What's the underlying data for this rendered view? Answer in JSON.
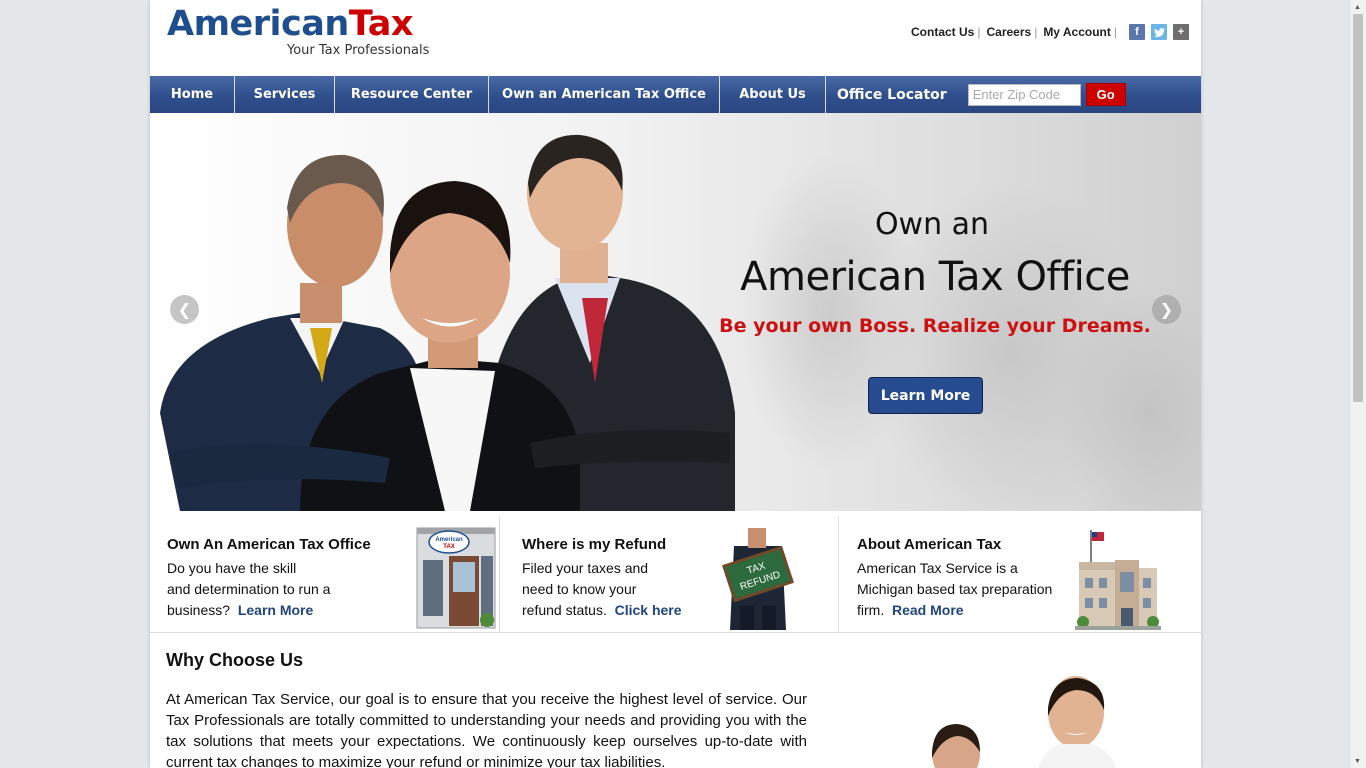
{
  "header": {
    "logo_part1": "American",
    "logo_part2": "Tax",
    "tagline": "Your Tax Professionals",
    "links": [
      "Contact Us",
      "Careers",
      "My Account"
    ],
    "social_icons": [
      "facebook-icon",
      "twitter-icon",
      "google-plus-icon"
    ]
  },
  "nav": {
    "items": [
      "Home",
      "Services",
      "Resource Center",
      "Own an American Tax Office",
      "About Us"
    ],
    "office_locator_label": "Office Locator",
    "zip_placeholder": "Enter Zip Code",
    "go_label": "Go"
  },
  "hero": {
    "line1": "Own an",
    "line2": "American Tax Office",
    "line3": "Be your own Boss. Realize your Dreams.",
    "button": "Learn More"
  },
  "features": [
    {
      "title": "Own An American Tax Office",
      "lines": [
        "Do you have the skill",
        "and determination to run a",
        "business?"
      ],
      "link": "Learn More",
      "image": "storefront-image"
    },
    {
      "title": "Where is my Refund",
      "lines": [
        "Filed your taxes and",
        "need to know your",
        "refund status."
      ],
      "link": "Click here",
      "image": "tax-refund-sign-image",
      "sign_text": "TAX REFUND"
    },
    {
      "title": "About American Tax",
      "lines": [
        "American Tax Service is a",
        "Michigan based tax preparation",
        "firm."
      ],
      "link": "Read More",
      "image": "office-building-image"
    }
  ],
  "storefront_sign": "American TAX",
  "why": {
    "title": "Why Choose Us",
    "text": "At American Tax Service, our goal is to ensure that you receive the highest level of service. Our Tax Professionals are totally committed to understanding your needs and providing you with the tax solutions that meets your expectations. We continuously keep ourselves up-to-date with current tax changes to maximize your refund or minimize your tax liabilities."
  },
  "colors": {
    "brand_blue": "#1f4e8f",
    "brand_red": "#cc0000",
    "nav_blue": "#2f4f8c"
  }
}
